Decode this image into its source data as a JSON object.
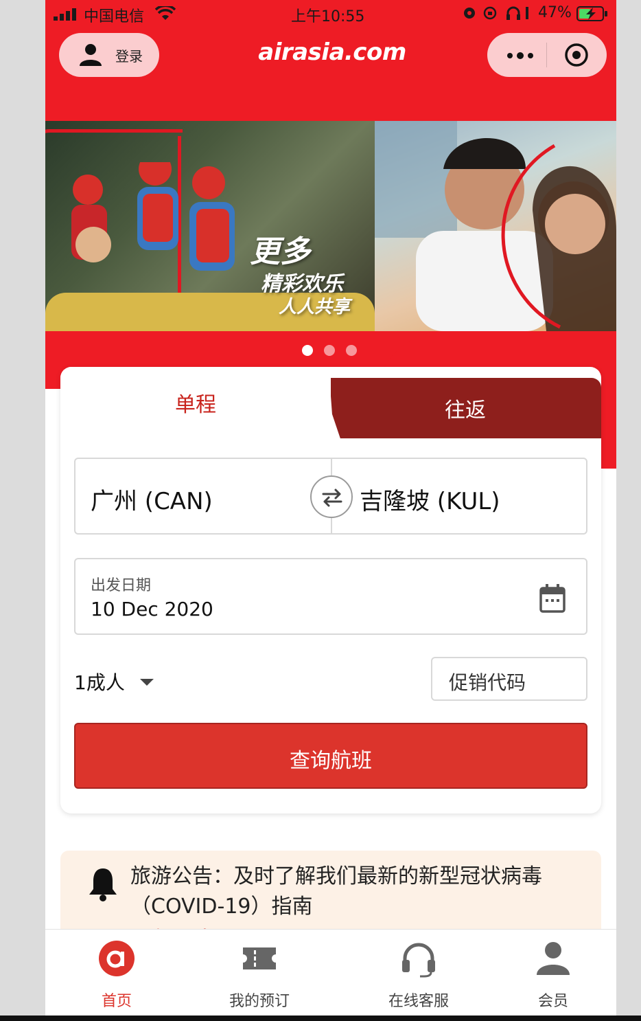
{
  "status_bar": {
    "carrier": "中国电信",
    "time": "上午10:55",
    "battery": "47%"
  },
  "header": {
    "login_label": "登录",
    "logo": "airasia.com"
  },
  "banner": {
    "headline": "更多",
    "sub1": "精彩欢乐",
    "sub2": "人人共享",
    "slides": 3,
    "active_slide": 1
  },
  "search": {
    "tabs": [
      {
        "label": "单程",
        "active": true
      },
      {
        "label": "往返",
        "active": false
      }
    ],
    "origin": "广州 (CAN)",
    "destination": "吉隆坡 (KUL)",
    "date_label": "出发日期",
    "date_value": "10 Dec 2020",
    "passengers": "1成人",
    "promo_placeholder": "促销代码",
    "search_button": "查询航班"
  },
  "notice": {
    "text": "旅游公告：及时了解我们最新的新型冠状病毒（COVID-19）指南",
    "link": "了解更多"
  },
  "tab_bar": [
    {
      "label": "首页",
      "icon": "airasia-home-icon",
      "active": true
    },
    {
      "label": "我的预订",
      "icon": "ticket-icon",
      "active": false
    },
    {
      "label": "在线客服",
      "icon": "headset-icon",
      "active": false
    },
    {
      "label": "会员",
      "icon": "user-icon",
      "active": false
    }
  ],
  "colors": {
    "brand_red": "#ee1c25",
    "dark_red": "#8e1f1c",
    "button_red": "#dc342c",
    "notice_bg": "#fdf1e6"
  }
}
